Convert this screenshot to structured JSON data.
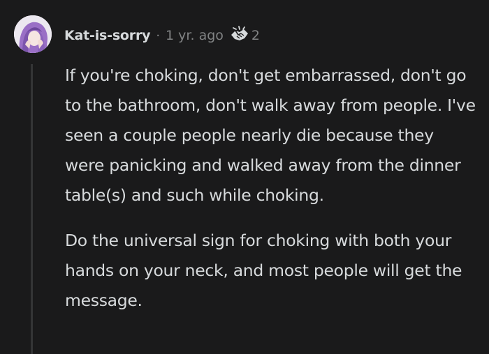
{
  "comment": {
    "author": "Kat-is-sorry",
    "separator": "·",
    "timestamp": "1 yr. ago",
    "award_icon": "handshake-award-icon",
    "award_count": "2",
    "paragraphs": [
      "If you're choking, don't get embarrassed, don't go to the bathroom, don't walk away from people. I've seen a couple people nearly die because they were panicking and walked away from the dinner table(s) and such while choking.",
      "Do the universal sign for choking with both your hands on your neck, and most people will get the message."
    ]
  },
  "colors": {
    "background": "#1a1a1b",
    "text": "#d7dadc",
    "muted": "#818384",
    "thread_line": "#343536"
  }
}
